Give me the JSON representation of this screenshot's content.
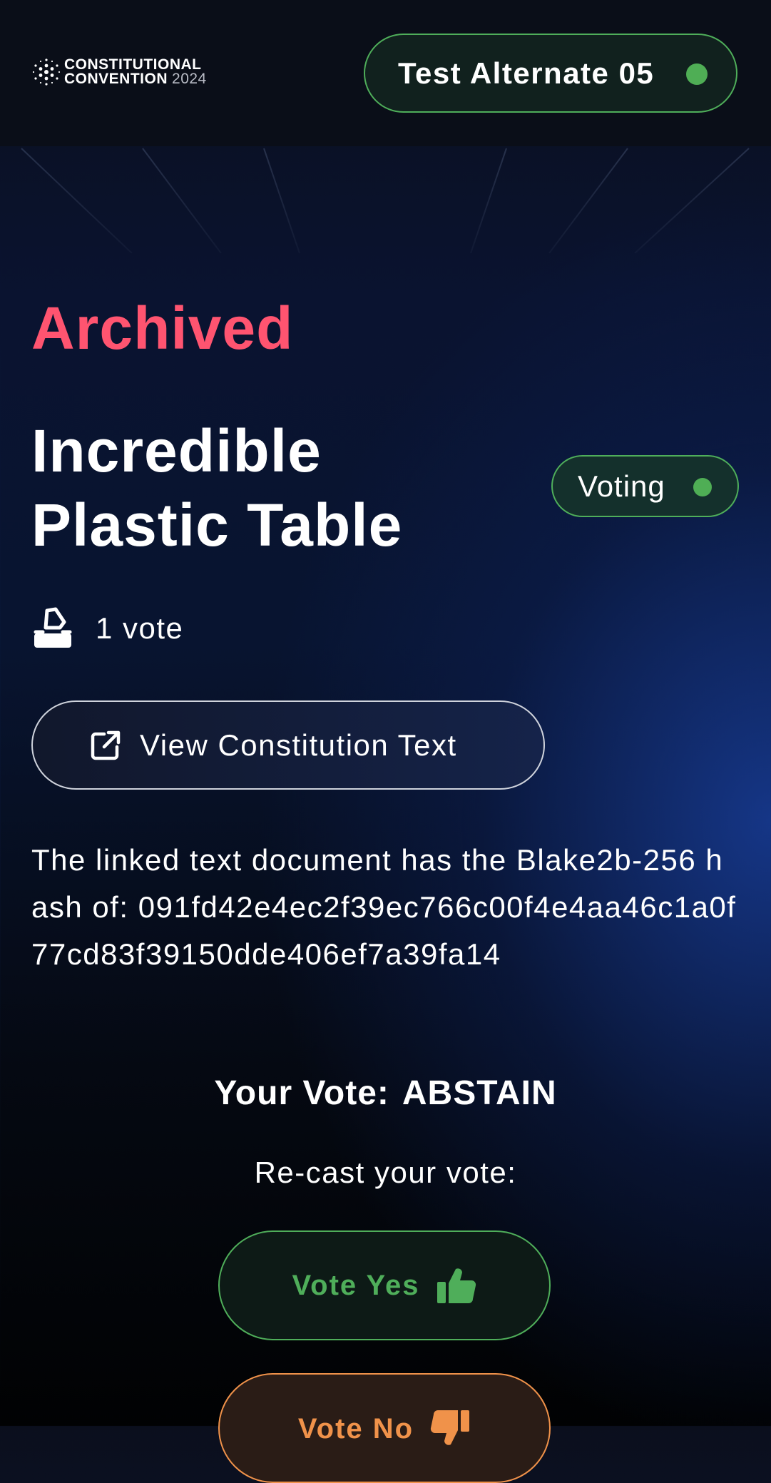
{
  "header": {
    "logo": {
      "line1": "CONSTITUTIONAL",
      "line2": "CONVENTION",
      "year": "2024"
    },
    "user": {
      "name": "Test Alternate 05",
      "status_color": "#4fae55"
    }
  },
  "proposal": {
    "status": "Archived",
    "title": "Incredible Plastic Table",
    "phase": "Voting",
    "vote_count": "1 vote",
    "view_button_label": "View Constitution Text",
    "hash_description": "The linked text document has the Blake2b-256 hash of: 091fd42e4ec2f39ec766c00f4e4aa46c1a0f77cd83f39150dde406ef7a39fa14"
  },
  "voting": {
    "your_vote_label": "Your Vote:",
    "your_vote_value": "ABSTAIN",
    "recast_label": "Re-cast your vote:",
    "yes_label": "Vote Yes",
    "no_label": "Vote No"
  },
  "colors": {
    "archived": "#ff5470",
    "yes_accent": "#4fae5a",
    "no_accent": "#f0924a"
  },
  "icons": [
    "constitutional-convention-logo",
    "ballot-box-icon",
    "external-link-icon",
    "thumbs-up-icon",
    "thumbs-down-icon"
  ]
}
